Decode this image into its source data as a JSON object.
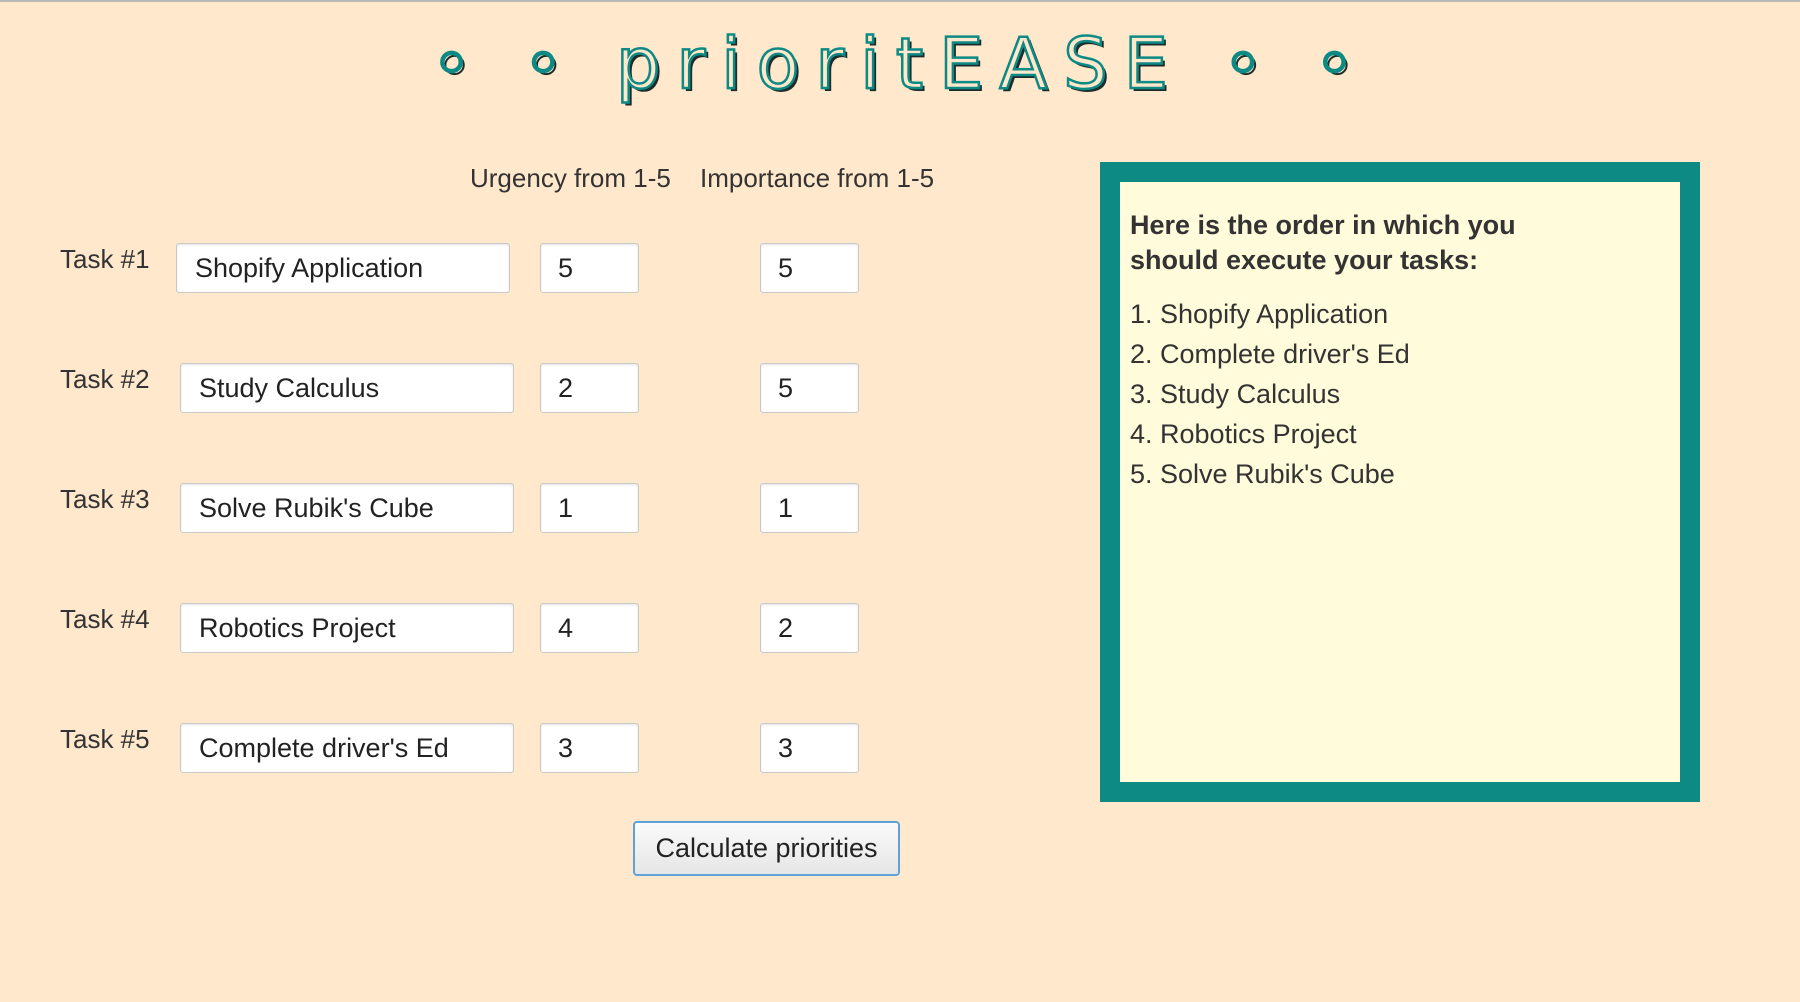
{
  "app": {
    "title_dots_left": "◦ ◦",
    "title_text": "prioritEASE",
    "title_dots_right": "◦ ◦"
  },
  "columns": {
    "urgency": "Urgency from 1-5",
    "importance": "Importance from 1-5"
  },
  "tasks": [
    {
      "label": "Task #1",
      "name": "Shopify Application",
      "urgency": "5",
      "importance": "5"
    },
    {
      "label": "Task #2",
      "name": "Study Calculus",
      "urgency": "2",
      "importance": "5"
    },
    {
      "label": "Task #3",
      "name": "Solve Rubik's Cube",
      "urgency": "1",
      "importance": "1"
    },
    {
      "label": "Task #4",
      "name": "Robotics Project",
      "urgency": "4",
      "importance": "2"
    },
    {
      "label": "Task #5",
      "name": "Complete driver's Ed",
      "urgency": "3",
      "importance": "3"
    }
  ],
  "calculate_button": "Calculate priorities",
  "result": {
    "heading": "Here is the order in which you should execute your tasks:",
    "items": [
      "1. Shopify Application",
      "2. Complete driver's Ed",
      "3. Study Calculus",
      "4. Robotics Project",
      "5. Solve Rubik's Cube"
    ]
  },
  "colors": {
    "background": "#ffe8cc",
    "accent_teal": "#0e8a85",
    "result_background": "#fffbdb",
    "button_border": "#5ea2d8"
  }
}
